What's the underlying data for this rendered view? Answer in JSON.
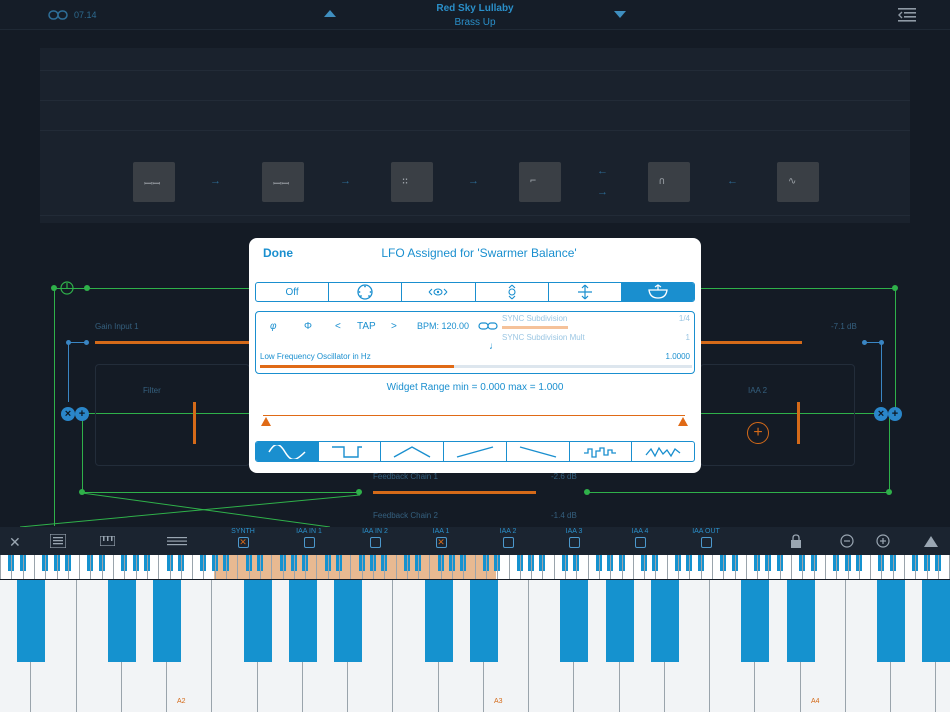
{
  "header": {
    "version": "07.14",
    "preset_name": "Red Sky Lullaby",
    "preset_sub": "Brass Up"
  },
  "background": {
    "gain_label": "Gain Input 1",
    "gain_value": "-7.1 dB",
    "filter_label": "Filter",
    "iaa2_label": "IAA 2",
    "feedback1_label": "Feedback Chain 1",
    "feedback1_value": "-2.6 dB",
    "feedback2_label": "Feedback Chain 2",
    "feedback2_value": "-1.4 dB"
  },
  "modal": {
    "done_label": "Done",
    "title": "LFO Assigned for 'Swarmer Balance'",
    "target_tabs": [
      {
        "label": "Off",
        "icon": "",
        "active": false
      },
      {
        "label": "",
        "icon": "dial-icon",
        "active": false
      },
      {
        "label": "",
        "icon": "eye-arrows-icon",
        "active": false
      },
      {
        "label": "",
        "icon": "vertical-arrows-icon",
        "active": false
      },
      {
        "label": "",
        "icon": "move-vertical-icon",
        "active": false
      },
      {
        "label": "",
        "icon": "bowl-icon",
        "active": true
      }
    ],
    "controls": {
      "phase_symbol": "φ",
      "invert_symbol": "Φ",
      "prev": "<",
      "tap": "TAP",
      "next": ">",
      "bpm": "BPM: 120.00"
    },
    "sync_subdivision_label": "SYNC Subdivision",
    "sync_subdivision_value": "1/4",
    "sync_subdivision_level": 0.45,
    "sync_mult_label": "SYNC Subdivision Mult",
    "sync_mult_value": "1",
    "freq_label": "Low Frequency Oscillator in Hz",
    "freq_value": "1.0000",
    "freq_level": 0.45,
    "range_text": "Widget Range min = 0.000 max = 1.000",
    "range_min": 0.0,
    "range_max": 1.0,
    "waveforms": [
      {
        "name": "sine",
        "active": true
      },
      {
        "name": "square",
        "active": false
      },
      {
        "name": "triangle",
        "active": false
      },
      {
        "name": "ramp-up",
        "active": false
      },
      {
        "name": "ramp-down",
        "active": false
      },
      {
        "name": "sample-hold",
        "active": false
      },
      {
        "name": "random",
        "active": false
      }
    ]
  },
  "toolbar": {
    "routes": [
      {
        "label": "SYNTH",
        "checked": true
      },
      {
        "label": "IAA IN 1",
        "checked": false
      },
      {
        "label": "IAA IN 2",
        "checked": false
      },
      {
        "label": "IAA 1",
        "checked": true
      },
      {
        "label": "IAA 2",
        "checked": false
      },
      {
        "label": "IAA 3",
        "checked": false
      },
      {
        "label": "IAA 4",
        "checked": false
      },
      {
        "label": "IAA OUT",
        "checked": false
      }
    ]
  },
  "keyboard": {
    "notes": [
      "A2",
      "A3",
      "A4"
    ]
  },
  "colors": {
    "accent": "#1a8fcf",
    "orange": "#e06a16",
    "green": "#2fb14a",
    "key_blue": "#1592cf"
  }
}
